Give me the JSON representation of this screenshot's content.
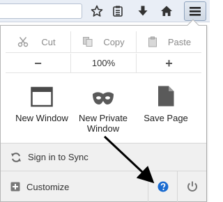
{
  "toolbar": {
    "buttons": [
      "bookmark-star-icon",
      "reading-list-icon",
      "download-icon",
      "home-icon",
      "menu-hamburger-icon"
    ]
  },
  "edit": {
    "cut": "Cut",
    "copy": "Copy",
    "paste": "Paste"
  },
  "zoom": {
    "minus": "−",
    "level": "100%",
    "plus": "+"
  },
  "items": [
    {
      "label": "New Window",
      "icon": "new-window-icon"
    },
    {
      "label": "New Private Window",
      "icon": "private-mask-icon"
    },
    {
      "label": "Save Page",
      "icon": "save-page-icon"
    }
  ],
  "footer": {
    "sync": "Sign in to Sync",
    "customize": "Customize"
  },
  "colors": {
    "help_icon": "#1a6bd0",
    "annotation_arrow": "#000000"
  }
}
